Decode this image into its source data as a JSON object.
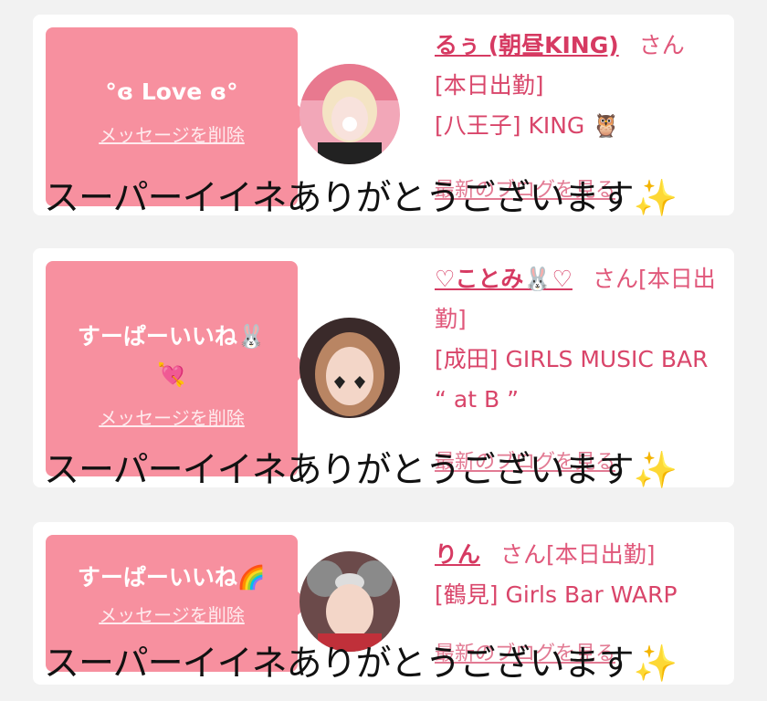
{
  "cards": [
    {
      "message": "°ɞ Love ɞ°",
      "delete_label": "メッセージを削除",
      "name": "るぅ (朝昼KING)",
      "honorific": "さん",
      "status": "[本日出勤]",
      "shop": "[八王子] KING 🦉",
      "blog_label": "最新のブログを見る",
      "avatar_icon": "profile-photo-blonde"
    },
    {
      "message_line1": "すーぱーいいね🐰",
      "message_line2": "💘",
      "delete_label": "メッセージを削除",
      "name": "♡ことみ🐰♡",
      "honorific_status": "さん[本日出勤]",
      "shop": "[成田] GIRLS MUSIC BAR “ at B ”",
      "blog_label": "最新のブログを見る",
      "avatar_icon": "profile-photo-hearts"
    },
    {
      "message": "すーぱーいいね🌈",
      "delete_label": "メッセージを削除",
      "name": "りん",
      "honorific_status": "さん[本日出勤]",
      "shop": "[鶴見] Girls Bar WARP",
      "blog_label": "最新のブログを見る",
      "avatar_icon": "profile-photo-mouse-ears"
    }
  ],
  "overlay_caption": "スーパーイイネありがとうございます",
  "overlay_emoji": "✨",
  "colors": {
    "bubble": "#f7909f",
    "name": "#d63a62",
    "text": "#d9456a"
  }
}
